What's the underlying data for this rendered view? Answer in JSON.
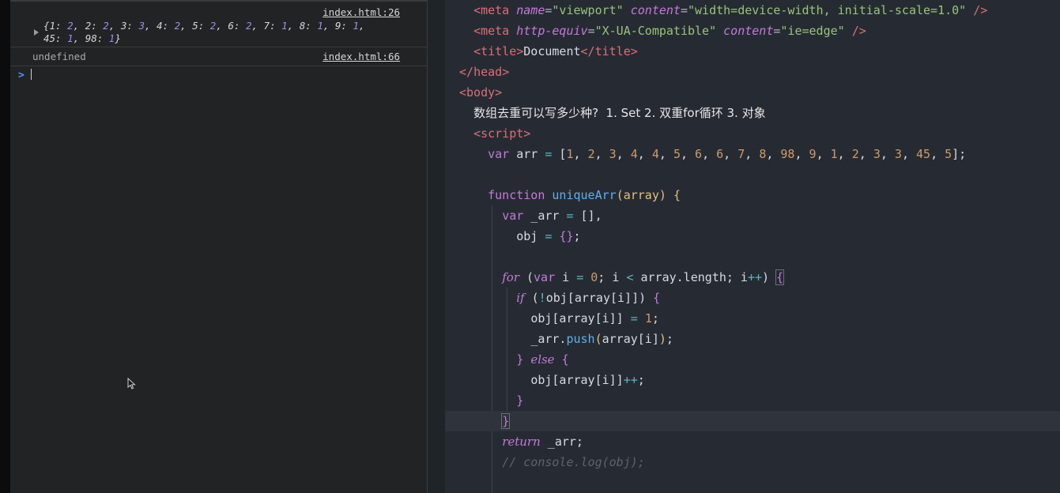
{
  "console": {
    "entries": [
      {
        "type": "object",
        "source": "index.html:26",
        "parts": [
          {
            "t": "{1: ",
            "n": false
          },
          {
            "t": "2",
            "n": true
          },
          {
            "t": ", 2: ",
            "n": false
          },
          {
            "t": "2",
            "n": true
          },
          {
            "t": ", 3: ",
            "n": false
          },
          {
            "t": "3",
            "n": true
          },
          {
            "t": ", 4: ",
            "n": false
          },
          {
            "t": "2",
            "n": true
          },
          {
            "t": ", 5: ",
            "n": false
          },
          {
            "t": "2",
            "n": true
          },
          {
            "t": ", 6: ",
            "n": false
          },
          {
            "t": "2",
            "n": true
          },
          {
            "t": ", 7: ",
            "n": false
          },
          {
            "t": "1",
            "n": true
          },
          {
            "t": ", 8: ",
            "n": false
          },
          {
            "t": "1",
            "n": true
          },
          {
            "t": ", 9: ",
            "n": false
          },
          {
            "t": "1",
            "n": true
          },
          {
            "t": ",\n45: ",
            "n": false
          },
          {
            "t": "1",
            "n": true
          },
          {
            "t": ", 98: ",
            "n": false
          },
          {
            "t": "1",
            "n": true
          },
          {
            "t": "}",
            "n": false
          }
        ]
      },
      {
        "type": "value",
        "source": "index.html:66",
        "text": "undefined"
      }
    ],
    "prompt": ">"
  },
  "editor": {
    "lines": [
      [
        [
          "  ",
          "p"
        ],
        [
          "<",
          "tag"
        ],
        [
          "meta",
          "tag"
        ],
        [
          " ",
          "p"
        ],
        [
          "name",
          "attr"
        ],
        [
          "=",
          "p"
        ],
        [
          "\"viewport\"",
          "str"
        ],
        [
          " ",
          "p"
        ],
        [
          "content",
          "attr"
        ],
        [
          "=",
          "p"
        ],
        [
          "\"width=device-width, initial-scale=1.0\"",
          "str"
        ],
        [
          " ",
          "p"
        ],
        [
          "/>",
          "tag"
        ]
      ],
      [
        [
          "  ",
          "p"
        ],
        [
          "<",
          "tag"
        ],
        [
          "meta",
          "tag"
        ],
        [
          " ",
          "p"
        ],
        [
          "http-equiv",
          "attr"
        ],
        [
          "=",
          "p"
        ],
        [
          "\"X-UA-Compatible\"",
          "str"
        ],
        [
          " ",
          "p"
        ],
        [
          "content",
          "attr"
        ],
        [
          "=",
          "p"
        ],
        [
          "\"ie=edge\"",
          "str"
        ],
        [
          " ",
          "p"
        ],
        [
          "/>",
          "tag"
        ]
      ],
      [
        [
          "  ",
          "p"
        ],
        [
          "<",
          "tag"
        ],
        [
          "title",
          "tag"
        ],
        [
          ">",
          "tag"
        ],
        [
          "Document",
          "var"
        ],
        [
          "</",
          "tag"
        ],
        [
          "title",
          "tag"
        ],
        [
          ">",
          "tag"
        ]
      ],
      [
        [
          "</",
          "tag"
        ],
        [
          "head",
          "tag"
        ],
        [
          ">",
          "tag"
        ]
      ],
      [
        [
          "<",
          "tag"
        ],
        [
          "body",
          "tag"
        ],
        [
          ">",
          "tag"
        ]
      ],
      [
        [
          "  ",
          "p"
        ],
        [
          "数组去重可以写多少种?  1. Set 2. 双重for循环 3. 对象",
          "text"
        ]
      ],
      [
        [
          "  ",
          "p"
        ],
        [
          "<",
          "tag"
        ],
        [
          "script",
          "tag"
        ],
        [
          ">",
          "tag"
        ]
      ],
      [
        [
          "    ",
          "p"
        ],
        [
          "var",
          "kw"
        ],
        [
          " arr ",
          "var"
        ],
        [
          "=",
          "op"
        ],
        [
          " [",
          "var"
        ],
        [
          "1",
          "num"
        ],
        [
          ", ",
          "var"
        ],
        [
          "2",
          "num"
        ],
        [
          ", ",
          "var"
        ],
        [
          "3",
          "num"
        ],
        [
          ", ",
          "var"
        ],
        [
          "4",
          "num"
        ],
        [
          ", ",
          "var"
        ],
        [
          "4",
          "num"
        ],
        [
          ", ",
          "var"
        ],
        [
          "5",
          "num"
        ],
        [
          ", ",
          "var"
        ],
        [
          "6",
          "num"
        ],
        [
          ", ",
          "var"
        ],
        [
          "6",
          "num"
        ],
        [
          ", ",
          "var"
        ],
        [
          "7",
          "num"
        ],
        [
          ", ",
          "var"
        ],
        [
          "8",
          "num"
        ],
        [
          ", ",
          "var"
        ],
        [
          "98",
          "num"
        ],
        [
          ", ",
          "var"
        ],
        [
          "9",
          "num"
        ],
        [
          ", ",
          "var"
        ],
        [
          "1",
          "num"
        ],
        [
          ", ",
          "var"
        ],
        [
          "2",
          "num"
        ],
        [
          ", ",
          "var"
        ],
        [
          "3",
          "num"
        ],
        [
          ", ",
          "var"
        ],
        [
          "3",
          "num"
        ],
        [
          ", ",
          "var"
        ],
        [
          "45",
          "num"
        ],
        [
          ", ",
          "var"
        ],
        [
          "5",
          "num"
        ],
        [
          "];",
          "var"
        ]
      ],
      [],
      [
        [
          "    ",
          "p"
        ],
        [
          "function",
          "kw"
        ],
        [
          " ",
          "p"
        ],
        [
          "uniqueArr",
          "fn"
        ],
        [
          "(",
          "paren"
        ],
        [
          "array",
          "param"
        ],
        [
          ")",
          "paren"
        ],
        [
          " ",
          "p"
        ],
        [
          "{",
          "bracey"
        ]
      ],
      [
        [
          "      ",
          "p"
        ],
        [
          "var",
          "kw"
        ],
        [
          " _arr ",
          "var"
        ],
        [
          "=",
          "op"
        ],
        [
          " [],",
          "var"
        ]
      ],
      [
        [
          "        ",
          "p"
        ],
        [
          "obj ",
          "var"
        ],
        [
          "=",
          "op"
        ],
        [
          " ",
          "p"
        ],
        [
          "{}",
          "bracem"
        ],
        [
          ";",
          "var"
        ]
      ],
      [],
      [
        [
          "      ",
          "p"
        ],
        [
          "for",
          "kwi"
        ],
        [
          " (",
          "var"
        ],
        [
          "var",
          "kw"
        ],
        [
          " i ",
          "var"
        ],
        [
          "=",
          "op"
        ],
        [
          " ",
          "p"
        ],
        [
          "0",
          "num"
        ],
        [
          "; i ",
          "var"
        ],
        [
          "<",
          "op"
        ],
        [
          " array.length; i",
          "var"
        ],
        [
          "++",
          "op"
        ],
        [
          ") ",
          "var"
        ],
        [
          "{",
          "bracemb"
        ]
      ],
      [
        [
          "        ",
          "p"
        ],
        [
          "if",
          "kwi"
        ],
        [
          " (",
          "var"
        ],
        [
          "!",
          "op"
        ],
        [
          "obj[array[i]]) ",
          "var"
        ],
        [
          "{",
          "bracem"
        ]
      ],
      [
        [
          "          ",
          "p"
        ],
        [
          "obj[array[i]] ",
          "var"
        ],
        [
          "=",
          "op"
        ],
        [
          " ",
          "p"
        ],
        [
          "1",
          "num"
        ],
        [
          ";",
          "var"
        ]
      ],
      [
        [
          "          ",
          "p"
        ],
        [
          "_arr.",
          "var"
        ],
        [
          "push",
          "method"
        ],
        [
          "(",
          "paren"
        ],
        [
          "array[i]",
          "var"
        ],
        [
          ")",
          "paren"
        ],
        [
          ";",
          "var"
        ]
      ],
      [
        [
          "        ",
          "p"
        ],
        [
          "}",
          "bracem"
        ],
        [
          " ",
          "p"
        ],
        [
          "else",
          "kwi"
        ],
        [
          " ",
          "p"
        ],
        [
          "{",
          "bracem"
        ]
      ],
      [
        [
          "          ",
          "p"
        ],
        [
          "obj[array[i]]",
          "var"
        ],
        [
          "++",
          "op"
        ],
        [
          ";",
          "var"
        ]
      ],
      [
        [
          "        ",
          "p"
        ],
        [
          "}",
          "bracem"
        ]
      ],
      [
        [
          "      ",
          "p"
        ],
        [
          "}",
          "bracemb"
        ]
      ],
      [
        [
          "      ",
          "p"
        ],
        [
          "return",
          "kwi"
        ],
        [
          " _arr;",
          "var"
        ]
      ],
      [
        [
          "      ",
          "p"
        ],
        [
          "// console.log(obj);",
          "comment"
        ]
      ]
    ]
  }
}
